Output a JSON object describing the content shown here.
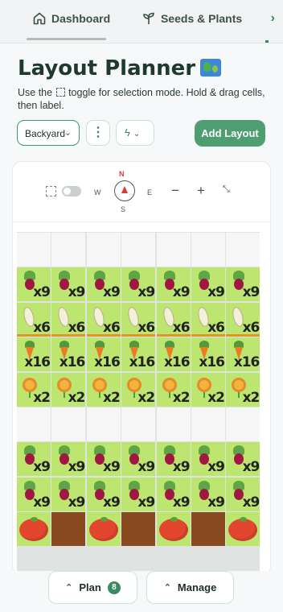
{
  "tabs": [
    {
      "label": "Dashboard",
      "icon": "home-icon"
    },
    {
      "label": "Seeds & Plants",
      "icon": "sprout-icon"
    }
  ],
  "page": {
    "title": "Layout Planner",
    "subtitle_before": "Use the",
    "subtitle_after": "toggle for selection mode. Hold & drag cells, then label."
  },
  "controls": {
    "layout_select": "Backyard",
    "add_layout": "Add Layout"
  },
  "map": {
    "west": "W",
    "north": "N",
    "east": "E",
    "south": "S",
    "zoom_out": "−",
    "zoom_in": "+"
  },
  "rows": [
    {
      "plant": "empty",
      "mult": ""
    },
    {
      "plant": "beet",
      "mult": "x9"
    },
    {
      "plant": "bean",
      "mult": "x6"
    },
    {
      "plant": "carrot",
      "mult": "x16"
    },
    {
      "plant": "flower",
      "mult": "x2"
    },
    {
      "plant": "empty",
      "mult": ""
    },
    {
      "plant": "beet",
      "mult": "x9"
    },
    {
      "plant": "beet",
      "mult": "x9"
    },
    {
      "plant": "tomato-soil",
      "mult": ""
    }
  ],
  "bottom": {
    "plan_label": "Plan",
    "plan_count": "8",
    "manage_label": "Manage"
  },
  "colors": {
    "accent": "#4f9e72",
    "planted_cell": "#bde671",
    "soil_cell": "#8a4a1f"
  }
}
